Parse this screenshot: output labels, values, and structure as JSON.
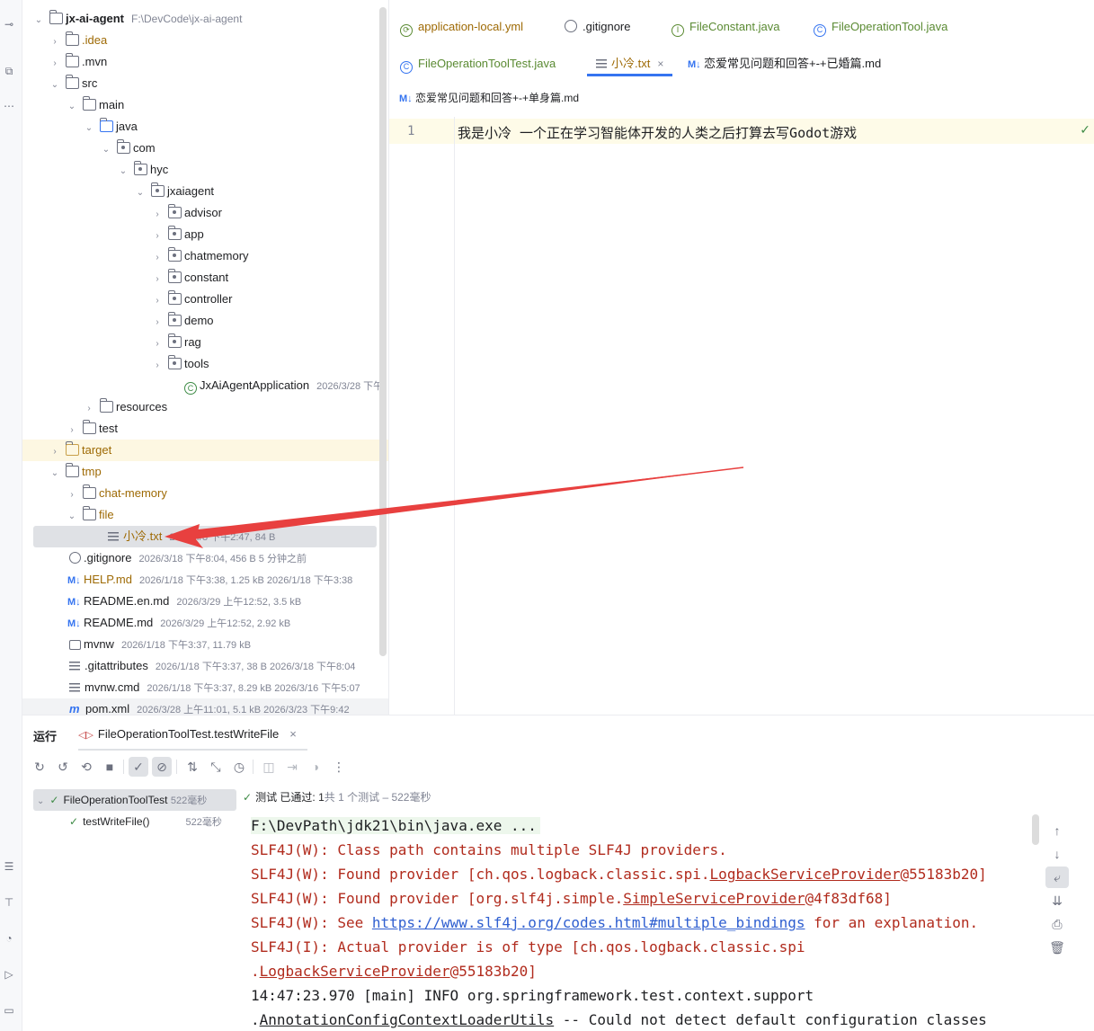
{
  "project": {
    "name": "jx-ai-agent",
    "path": "F:\\DevCode\\jx-ai-agent"
  },
  "tree": [
    {
      "label": ".idea",
      "kind": "folder",
      "color": "orange"
    },
    {
      "label": ".mvn",
      "kind": "folder"
    },
    {
      "label": "src",
      "kind": "folder"
    },
    {
      "label": "main",
      "kind": "folder"
    },
    {
      "label": "java",
      "kind": "folder"
    },
    {
      "label": "com",
      "kind": "folder"
    },
    {
      "label": "hyc",
      "kind": "folder"
    },
    {
      "label": "jxaiagent",
      "kind": "folder"
    },
    {
      "label": "advisor",
      "kind": "folder"
    },
    {
      "label": "app",
      "kind": "folder"
    },
    {
      "label": "chatmemory",
      "kind": "folder"
    },
    {
      "label": "constant",
      "kind": "folder"
    },
    {
      "label": "controller",
      "kind": "folder"
    },
    {
      "label": "demo",
      "kind": "folder"
    },
    {
      "label": "rag",
      "kind": "folder"
    },
    {
      "label": "tools",
      "kind": "folder"
    },
    {
      "label": "JxAiAgentApplication",
      "kind": "class",
      "meta": "2026/3/28 下午"
    },
    {
      "label": "resources",
      "kind": "folder"
    },
    {
      "label": "test",
      "kind": "folder"
    },
    {
      "label": "target",
      "kind": "folder",
      "color": "orange"
    },
    {
      "label": "tmp",
      "kind": "folder",
      "color": "orange"
    },
    {
      "label": "chat-memory",
      "kind": "folder",
      "color": "orange"
    },
    {
      "label": "file",
      "kind": "folder",
      "color": "orange"
    },
    {
      "label": "小冷.txt",
      "kind": "txt",
      "color": "orange",
      "meta": "2026/4/8 下午2:47, 84 B"
    },
    {
      "label": ".gitignore",
      "kind": "gitignore",
      "meta": "2026/3/18 下午8:04, 456 B 5 分钟之前"
    },
    {
      "label": "HELP.md",
      "kind": "md",
      "color": "orange",
      "meta": "2026/1/18 下午3:38, 1.25 kB 2026/1/18 下午3:38"
    },
    {
      "label": "README.en.md",
      "kind": "md",
      "meta": "2026/3/29 上午12:52, 3.5 kB"
    },
    {
      "label": "README.md",
      "kind": "md",
      "meta": "2026/3/29 上午12:52, 2.92 kB"
    },
    {
      "label": "mvnw",
      "kind": "exe",
      "meta": "2026/1/18 下午3:37, 11.79 kB"
    },
    {
      "label": ".gitattributes",
      "kind": "lines",
      "meta": "2026/1/18 下午3:37, 38 B 2026/3/18 下午8:04"
    },
    {
      "label": "mvnw.cmd",
      "kind": "lines",
      "meta": "2026/1/18 下午3:37, 8.29 kB 2026/3/16 下午5:07"
    },
    {
      "label": "pom.xml",
      "kind": "maven",
      "meta": "2026/3/28 上午11:01, 5.1 kB 2026/3/23 下午9:42"
    }
  ],
  "tabs": {
    "row1": [
      "application-local.yml",
      ".gitignore",
      "FileConstant.java",
      "FileOperationTool.java"
    ],
    "row2": [
      "FileOperationToolTest.java",
      "小冷.txt",
      "恋爱常见问题和回答+-+已婚篇.md"
    ],
    "row3": [
      "恋爱常见问题和回答+-+单身篇.md"
    ],
    "md_badge": "M↓"
  },
  "editor": {
    "line_number": "1",
    "content": "我是小冷 一个正在学习智能体开发的人类之后打算去写Godot游戏"
  },
  "run": {
    "title": "运行",
    "tab_label": "FileOperationToolTest.testWriteFile",
    "suite_name": "FileOperationToolTest",
    "suite_time": "522毫秒",
    "test_name": "testWriteFile()",
    "test_time": "522毫秒",
    "status_prefix": "测试 已通过:",
    "status_count": "1",
    "status_suffix": "共 1 个测试 – 522毫秒"
  },
  "console": {
    "cmd": "F:\\DevPath\\jdk21\\bin\\java.exe ...",
    "l2": "SLF4J(W): Class path contains multiple SLF4J providers.",
    "l3a": "SLF4J(W): Found provider [ch.qos.logback.classic.spi.",
    "l3b": "LogbackServiceProvider",
    "l3c": "@55183b20]",
    "l4a": "SLF4J(W): Found provider [org.slf4j.simple.",
    "l4b": "SimpleServiceProvider",
    "l4c": "@4f83df68]",
    "l5a": "SLF4J(W): See ",
    "l5link": "https://www.slf4j.org/codes.html#multiple_bindings",
    "l5c": " for an explanation.",
    "l6": "SLF4J(I): Actual provider is of type [ch.qos.logback.classic.spi",
    "l7a": " .",
    "l7b": "LogbackServiceProvider",
    "l7c": "@55183b20]",
    "l8": "14:47:23.970 [main] INFO org.springframework.test.context.support",
    "l9a": " .",
    "l9b": "AnnotationConfigContextLoaderUtils",
    "l9c": " -- Could not detect default configuration classes"
  },
  "colors": {
    "accent": "#3574f0",
    "annotation_arrow": "#e8403f",
    "error_text": "#b12b1d",
    "pass_green": "#3e8b46"
  }
}
